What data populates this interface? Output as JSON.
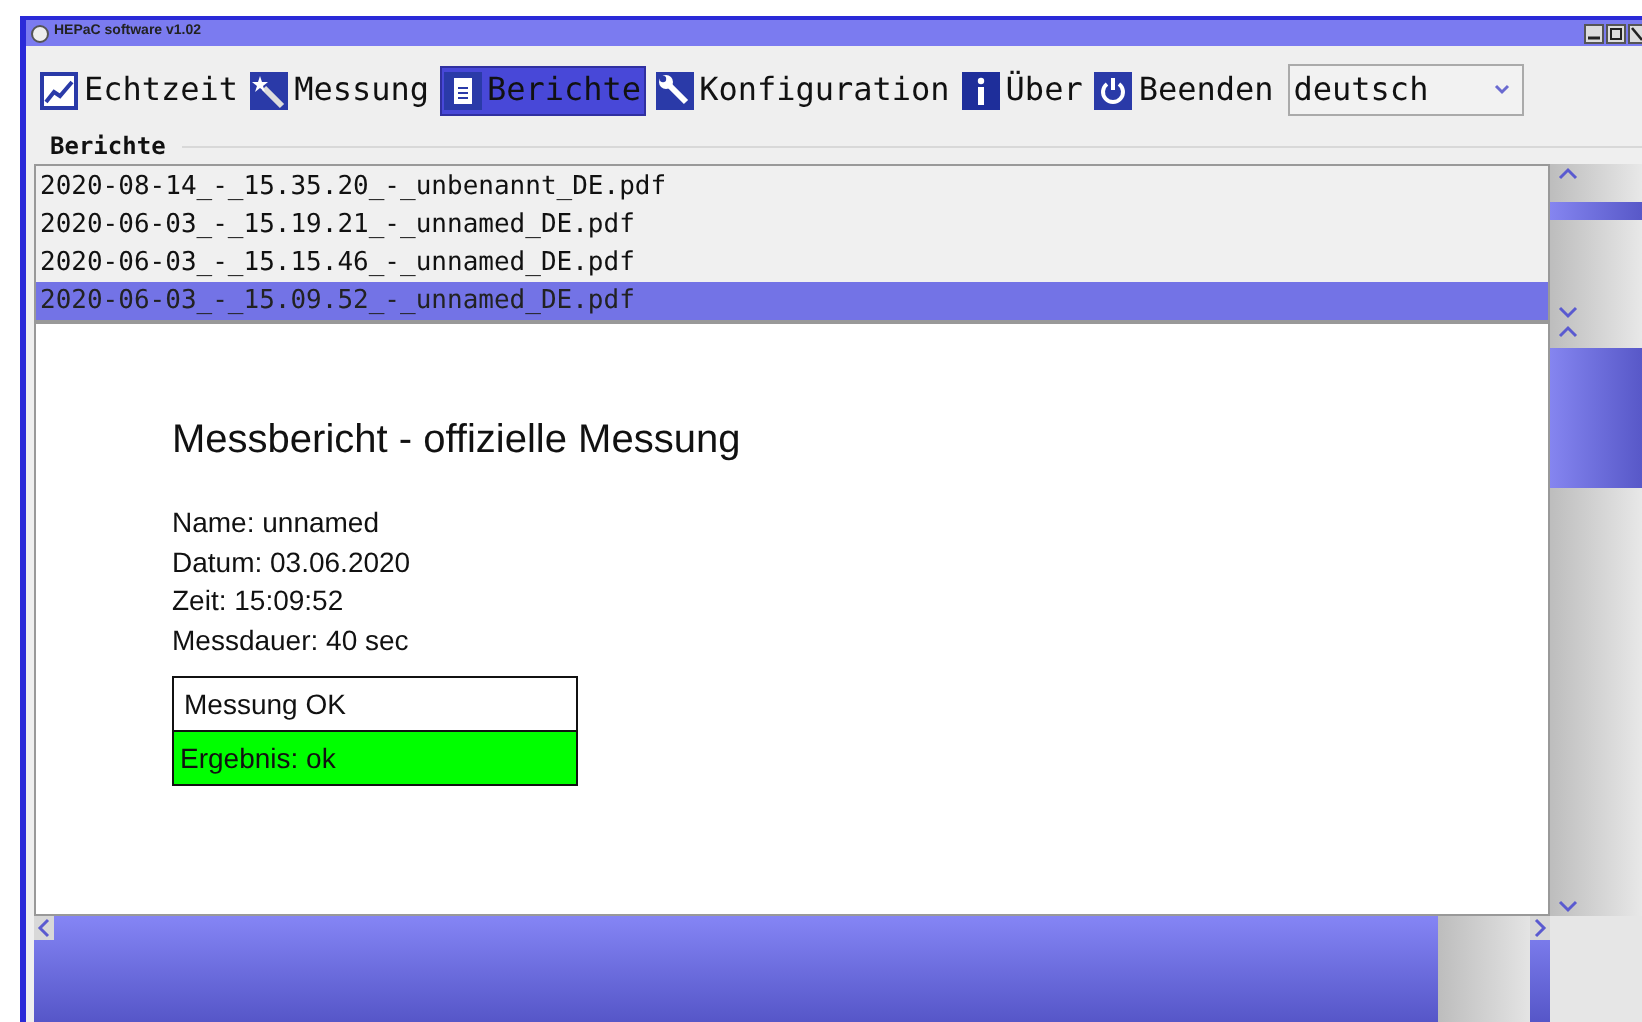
{
  "window": {
    "title": "HEPaC software v1.02"
  },
  "tabs": [
    {
      "label": "Echtzeit",
      "selected": false
    },
    {
      "label": "Messung",
      "selected": false
    },
    {
      "label": "Berichte",
      "selected": true
    },
    {
      "label": "Konfiguration",
      "selected": false
    },
    {
      "label": "Über",
      "selected": false
    },
    {
      "label": "Beenden",
      "selected": false
    }
  ],
  "language": {
    "value": "deutsch"
  },
  "group": {
    "label": "Berichte"
  },
  "files": [
    {
      "name": "2020-08-14_-_15.35.20_-_unbenannt_DE.pdf",
      "selected": false
    },
    {
      "name": "2020-06-03_-_15.19.21_-_unnamed_DE.pdf",
      "selected": false
    },
    {
      "name": "2020-06-03_-_15.15.46_-_unnamed_DE.pdf",
      "selected": false
    },
    {
      "name": "2020-06-03_-_15.09.52_-_unnamed_DE.pdf",
      "selected": true
    }
  ],
  "report": {
    "title": "Messbericht - offizielle Messung",
    "lines": [
      "Name: unnamed",
      "Datum: 03.06.2020",
      "Zeit: 15:09:52",
      "Messdauer: 40 sec"
    ],
    "status": "Messung OK",
    "result": {
      "text": "Ergebnis: ok",
      "passed": true
    }
  }
}
